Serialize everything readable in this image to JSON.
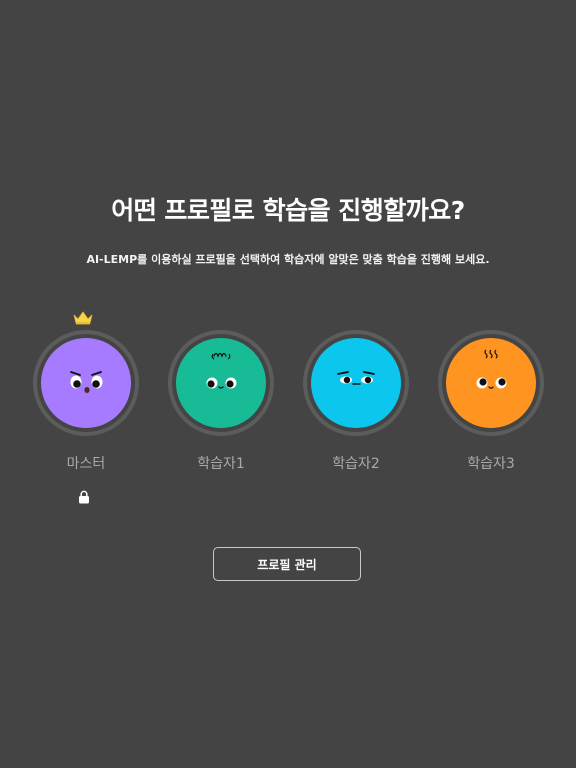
{
  "header": {
    "title": "어떤 프로필로 학습을 진행할까요?",
    "subtitle": "AI-LEMP를 이용하실 프로필을 선택하여 학습자에 알맞은 맞춤 학습을 진행해 보세요."
  },
  "profiles": [
    {
      "name": "마스터",
      "color": "#A77BFF",
      "badge": "crown-icon",
      "locked": true
    },
    {
      "name": "학습자1",
      "color": "#17BC97"
    },
    {
      "name": "학습자2",
      "color": "#0CC6EE"
    },
    {
      "name": "학습자3",
      "color": "#FF9421"
    }
  ],
  "actions": {
    "manage_label": "프로필 관리"
  },
  "colors": {
    "background": "#444444",
    "ring": "#5c5c5c",
    "crown": "#F6D24E"
  }
}
